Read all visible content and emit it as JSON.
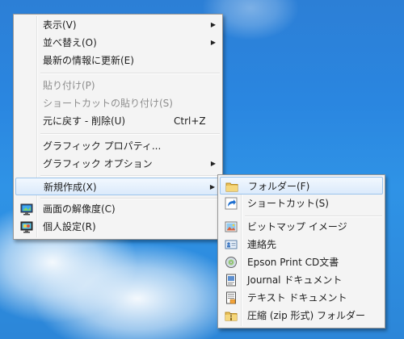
{
  "context_menu": {
    "items": [
      {
        "label": "表示(V)",
        "has_submenu": true
      },
      {
        "label": "並べ替え(O)",
        "has_submenu": true
      },
      {
        "label": "最新の情報に更新(E)"
      },
      {
        "label": "貼り付け(P)",
        "disabled": true
      },
      {
        "label": "ショートカットの貼り付け(S)",
        "disabled": true
      },
      {
        "label": "元に戻す - 削除(U)",
        "shortcut": "Ctrl+Z"
      },
      {
        "label": "グラフィック プロパティ..."
      },
      {
        "label": "グラフィック オプション",
        "has_submenu": true
      },
      {
        "label": "新規作成(X)",
        "has_submenu": true,
        "highlighted": true
      },
      {
        "label": "画面の解像度(C)",
        "icon": "display-icon"
      },
      {
        "label": "個人設定(R)",
        "icon": "personalize-icon"
      }
    ]
  },
  "new_submenu": {
    "items": [
      {
        "label": "フォルダー(F)",
        "icon": "folder-icon",
        "highlighted": true
      },
      {
        "label": "ショートカット(S)",
        "icon": "shortcut-icon"
      },
      {
        "label": "ビットマップ イメージ",
        "icon": "bitmap-icon"
      },
      {
        "label": "連絡先",
        "icon": "contact-icon"
      },
      {
        "label": "Epson Print CD文書",
        "icon": "epson-cd-icon"
      },
      {
        "label": "Journal ドキュメント",
        "icon": "journal-icon"
      },
      {
        "label": "テキスト ドキュメント",
        "icon": "text-document-icon"
      },
      {
        "label": "圧縮 (zip 形式) フォルダー",
        "icon": "zip-folder-icon"
      }
    ]
  }
}
